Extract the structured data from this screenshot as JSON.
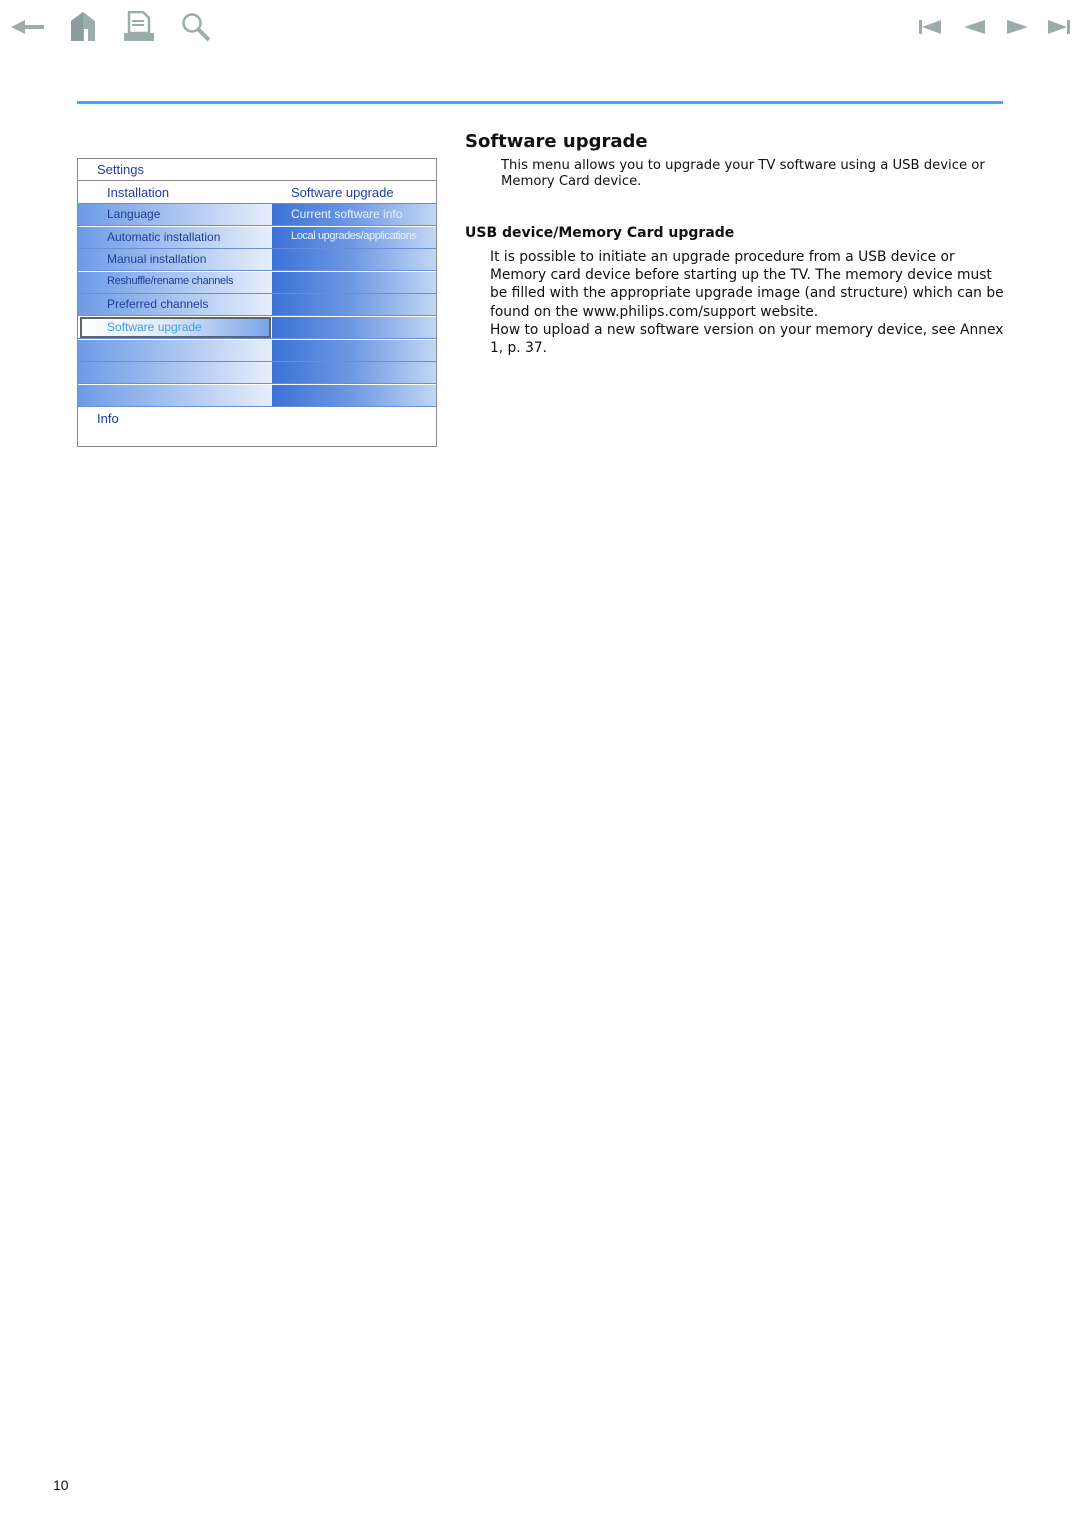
{
  "toolbar": {
    "left_icons": [
      "back-arrow-icon",
      "home-icon",
      "print-icon",
      "search-icon"
    ],
    "right_icons": [
      "first-page-icon",
      "previous-page-icon",
      "next-page-icon",
      "last-page-icon"
    ],
    "icon_color": "#9aadab"
  },
  "accent_color": "#39b0ef",
  "tv_menu": {
    "title": "Settings",
    "header_left": "Installation",
    "header_right": "Software upgrade",
    "left_items": [
      {
        "label": "Language"
      },
      {
        "label": "Automatic installation"
      },
      {
        "label": "Manual installation"
      },
      {
        "label": "Reshuffle/rename channels"
      },
      {
        "label": "Preferred channels"
      },
      {
        "label": "Software upgrade",
        "selected": true
      },
      {
        "label": ""
      },
      {
        "label": ""
      },
      {
        "label": ""
      }
    ],
    "right_items": [
      {
        "label": "Current software info"
      },
      {
        "label": "Local upgrades/applications"
      },
      {
        "label": ""
      },
      {
        "label": ""
      },
      {
        "label": ""
      },
      {
        "label": ""
      },
      {
        "label": ""
      },
      {
        "label": ""
      },
      {
        "label": ""
      }
    ],
    "info_label": "Info"
  },
  "content": {
    "title": "Software upgrade",
    "intro": "This menu allows you to upgrade your TV software using a USB device or Memory Card device.",
    "section_title": "USB device/Memory Card upgrade",
    "paragraph1": "It is possible to initiate an upgrade procedure from a USB device or Memory card device before starting up the TV. The memory device must be filled with the appropriate upgrade image (and structure) which can be found on the www.philips.com/support website.",
    "paragraph2": "How to upload a new software version on your memory device, see Annex 1, p. 37."
  },
  "page_number": "10"
}
